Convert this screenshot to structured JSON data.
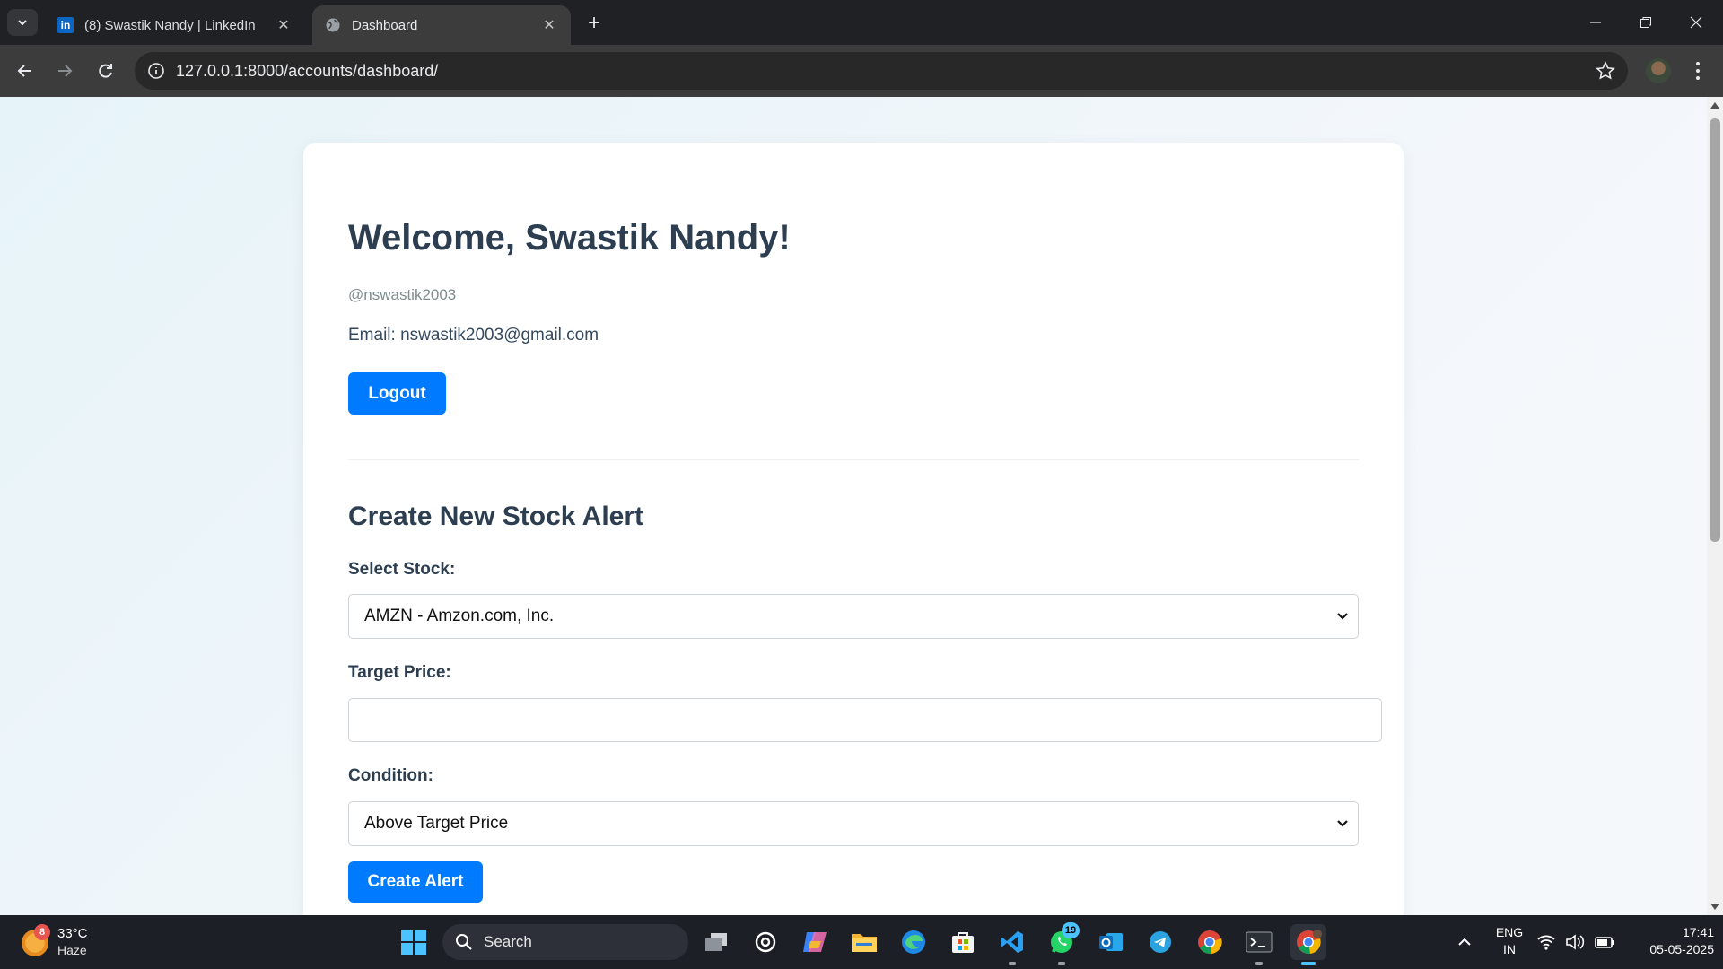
{
  "browser": {
    "tabs": [
      {
        "title": "(8) Swastik Nandy | LinkedIn",
        "favicon": "linkedin-icon",
        "active": false
      },
      {
        "title": "Dashboard",
        "favicon": "globe-icon",
        "active": true
      }
    ],
    "url": "127.0.0.1:8000/accounts/dashboard/"
  },
  "page": {
    "welcome": "Welcome, Swastik Nandy!",
    "handle": "@nswastik2003",
    "email": "Email: nswastik2003@gmail.com",
    "logout_label": "Logout",
    "alert_heading": "Create New Stock Alert",
    "stock_label": "Select Stock:",
    "stock_value": "AMZN - Amzon.com, Inc.",
    "price_label": "Target Price:",
    "price_value": "",
    "condition_label": "Condition:",
    "condition_value": "Above Target Price",
    "create_label": "Create Alert"
  },
  "taskbar": {
    "weather_temp": "33°C",
    "weather_cond": "Haze",
    "weather_badge": "8",
    "search_label": "Search",
    "whatsapp_badge": "19",
    "lang_1": "ENG",
    "lang_2": "IN",
    "time": "17:41",
    "date": "05-05-2025"
  },
  "colors": {
    "accent": "#007bff",
    "heading": "#2c3e50",
    "chrome_dark": "#202124",
    "taskbar": "#1c1f26"
  }
}
